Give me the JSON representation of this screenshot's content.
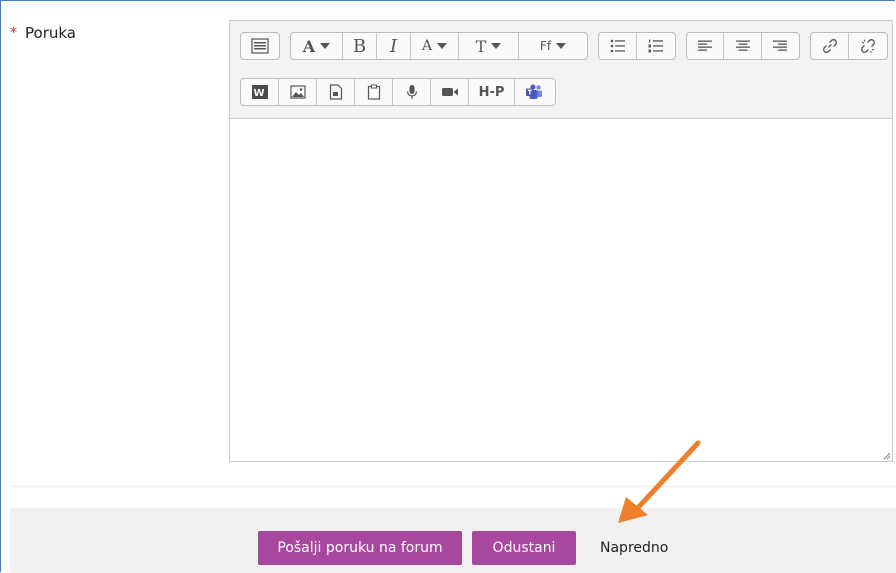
{
  "form": {
    "message_label": "Poruka",
    "required_marker": "*"
  },
  "toolbar": {
    "font_size_label": "A",
    "bold_label": "B",
    "italic_label": "I",
    "text_color_label": "A",
    "text_size_label": "T",
    "font_family_label": "Ff",
    "h5p_label": "H-P"
  },
  "icons": [
    "toolbar-toggle-icon",
    "font-icon",
    "bold-icon",
    "italic-icon",
    "font-color-icon",
    "text-size-icon",
    "font-family-icon",
    "unordered-list-icon",
    "ordered-list-icon",
    "align-left-icon",
    "align-center-icon",
    "align-right-icon",
    "link-icon",
    "unlink-icon",
    "word-import-icon",
    "image-icon",
    "media-icon",
    "paste-icon",
    "microphone-icon",
    "video-icon",
    "h5p-icon",
    "teams-icon",
    "resize-handle-icon",
    "arrow-annotation-icon"
  ],
  "buttons": {
    "submit_label": "Pošalji poruku na forum",
    "cancel_label": "Odustani",
    "advanced_label": "Napredno"
  },
  "colors": {
    "primary": "#a8479e",
    "required": "#ca3120",
    "annotation_arrow": "#ee7f2d",
    "frame_border": "#4a7ac7"
  }
}
